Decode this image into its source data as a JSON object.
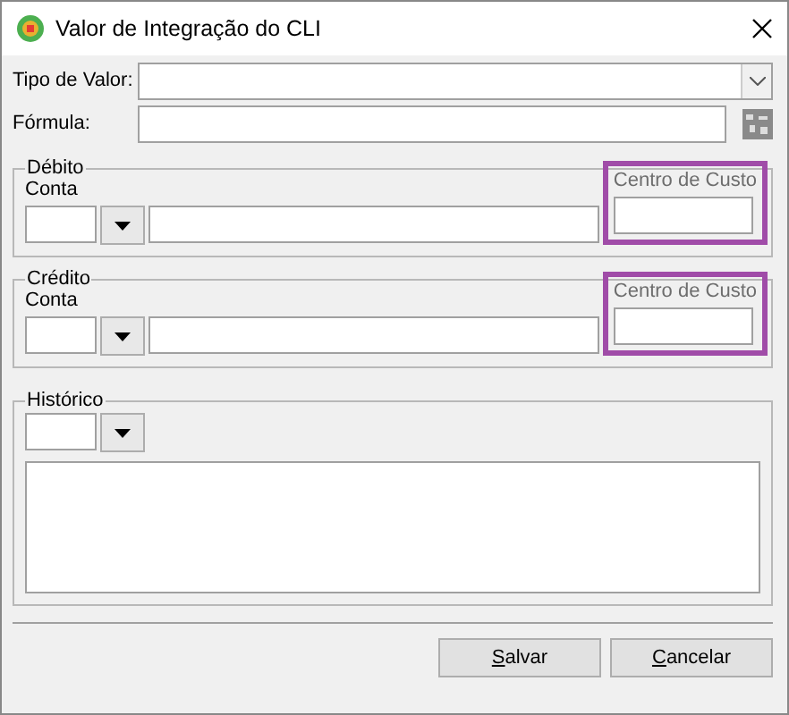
{
  "window": {
    "title": "Valor de Integração do CLI"
  },
  "tipo_valor": {
    "label": "Tipo de Valor:"
  },
  "formula": {
    "label": "Fórmula:"
  },
  "sections": [
    {
      "legend": "Débito",
      "conta_label": "Conta",
      "centro_label": "Centro de Custo",
      "highlighted": true
    },
    {
      "legend": "Crédito",
      "conta_label": "Conta",
      "centro_label": "Centro de Custo",
      "highlighted": true
    }
  ],
  "historico": {
    "legend": "Histórico"
  },
  "buttons": [
    {
      "label": "Salvar",
      "mnemonic": true
    },
    {
      "label": "Cancelar",
      "mnemonic": true
    }
  ]
}
